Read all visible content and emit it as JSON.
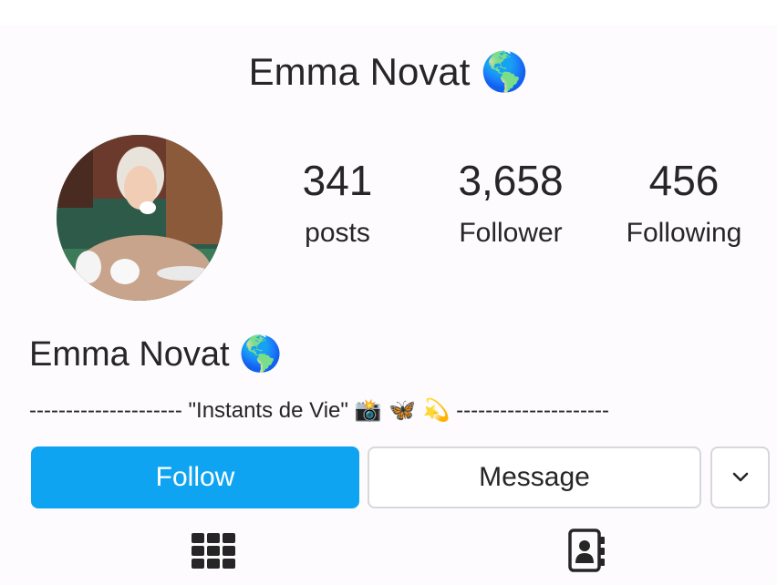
{
  "header": {
    "username": "Emma Novat",
    "emoji": "🌎"
  },
  "profile": {
    "avatar_alt": "profile photo",
    "stats": [
      {
        "value": "341",
        "label": "posts"
      },
      {
        "value": "3,658",
        "label": "Follower"
      },
      {
        "value": "456",
        "label": "Following"
      }
    ],
    "name": "Emma Novat",
    "name_emoji": "🌎",
    "bio_dashes_left": "---------------------",
    "bio_text": "\"Instants de Vie\"",
    "bio_emojis": "📸 🦋 💫",
    "bio_dashes_right": "---------------------"
  },
  "actions": {
    "follow_label": "Follow",
    "message_label": "Message",
    "more_icon": "chevron-down-icon"
  },
  "tabs": [
    {
      "icon": "grid-icon"
    },
    {
      "icon": "tagged-contact-icon"
    }
  ],
  "colors": {
    "accent": "#0fa4f2",
    "text": "#262626",
    "border": "#d7d7dc"
  }
}
